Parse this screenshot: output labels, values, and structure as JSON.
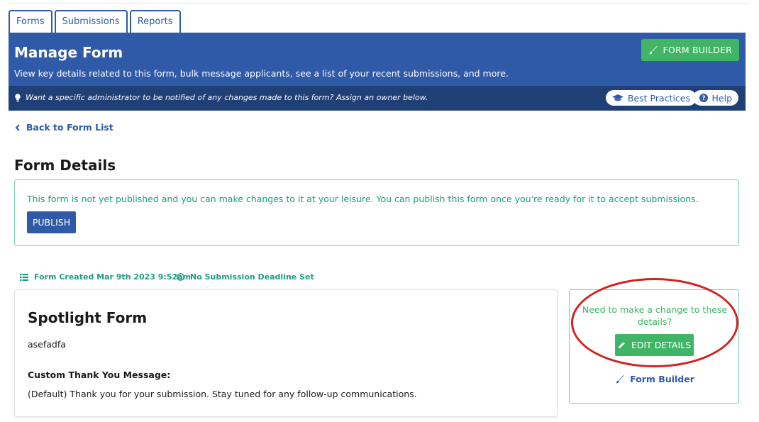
{
  "tabs": [
    "Forms",
    "Submissions",
    "Reports"
  ],
  "header": {
    "title": "Manage Form",
    "subtitle": "View key details related to this form, bulk message applicants, see a list of your recent submissions, and more.",
    "form_builder_button": "FORM BUILDER"
  },
  "notice": {
    "message": "Want a specific administrator to be notified of any changes made to this form? Assign an owner below.",
    "best_practices": "Best Practices",
    "help": "Help"
  },
  "nav": {
    "back_link": "Back to Form List"
  },
  "form_details": {
    "title": "Form Details",
    "publish_message": "This form is not yet published and you can make changes to it at your leisure. You can publish this form once you're ready for it to accept submissions.",
    "publish_button": "PUBLISH"
  },
  "meta": {
    "created": "Form Created Mar 9th 2023 9:52am",
    "deadline": "No Submission Deadline Set"
  },
  "card": {
    "form_name": "Spotlight Form",
    "description": "asefadfa",
    "thank_you_label": "Custom Thank You Message:",
    "thank_you_message": "(Default) Thank you for your submission. Stay tuned for any follow-up communications."
  },
  "side_panel": {
    "question": "Need to make a change to these details?",
    "edit_button": "EDIT DETAILS",
    "form_builder_link": "Form Builder"
  },
  "colors": {
    "primary": "#2f5aa8",
    "primary_dark": "#1f3f77",
    "success": "#3fb565",
    "teal": "#1b9e83",
    "annotation": "#d0231e"
  }
}
